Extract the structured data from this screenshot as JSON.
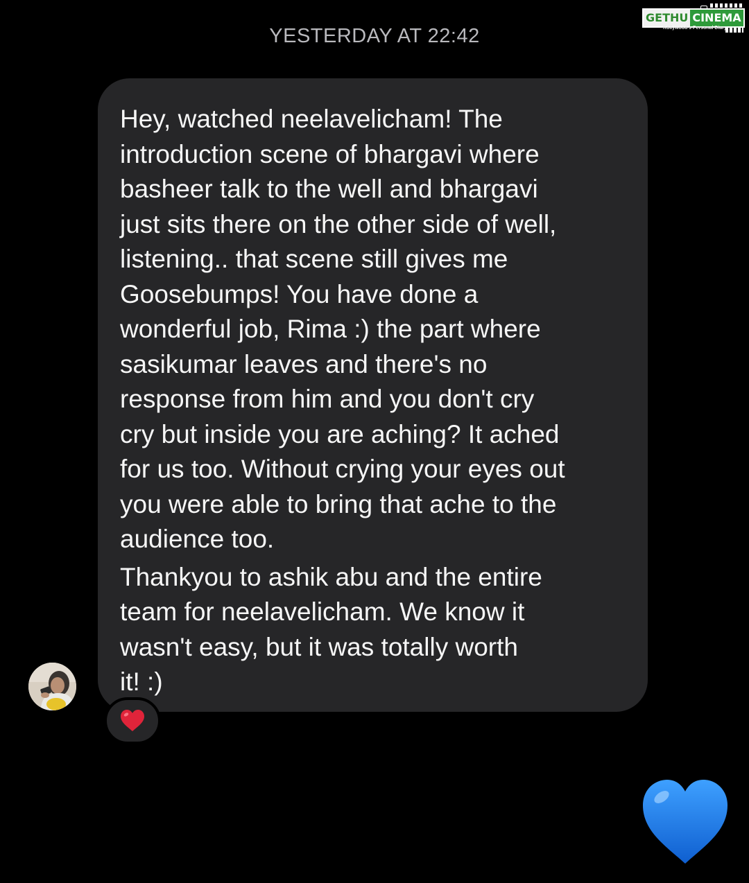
{
  "thread": {
    "timestamp": "YESTERDAY AT 22:42"
  },
  "watermark": {
    "left_text": "GETHU",
    "right_text": "CINEMA",
    "tagline": "Kollywood's Personal Diary"
  },
  "message": {
    "paragraph_1": "Hey, watched neelavelicham! The\nintroduction scene of bhargavi where\nbasheer talk to the well and bhargavi\njust sits there on the other side of well,\nlistening.. that scene still gives me\nGoosebumps! You have done a\nwonderful job, Rima :) the part where\nsasikumar leaves and there's no\nresponse from him and you don't cry\ncry but inside you are aching? It ached\nfor us too. Without crying your eyes out\nyou were able to bring that ache to the\naudience too.",
    "paragraph_2": "Thankyou to ashik abu and the entire\nteam for neelavelicham. We know it\nwasn't easy, but it was totally worth\nit! :)",
    "reaction_icon": "red-heart-icon"
  },
  "sent": {
    "icon": "blue-heart-icon"
  },
  "colors": {
    "background": "#000000",
    "bubble": "#262628",
    "timestamp": "#b9b9bd",
    "reaction_heart": "#e0243a",
    "sent_heart": "#1f7fe8"
  }
}
